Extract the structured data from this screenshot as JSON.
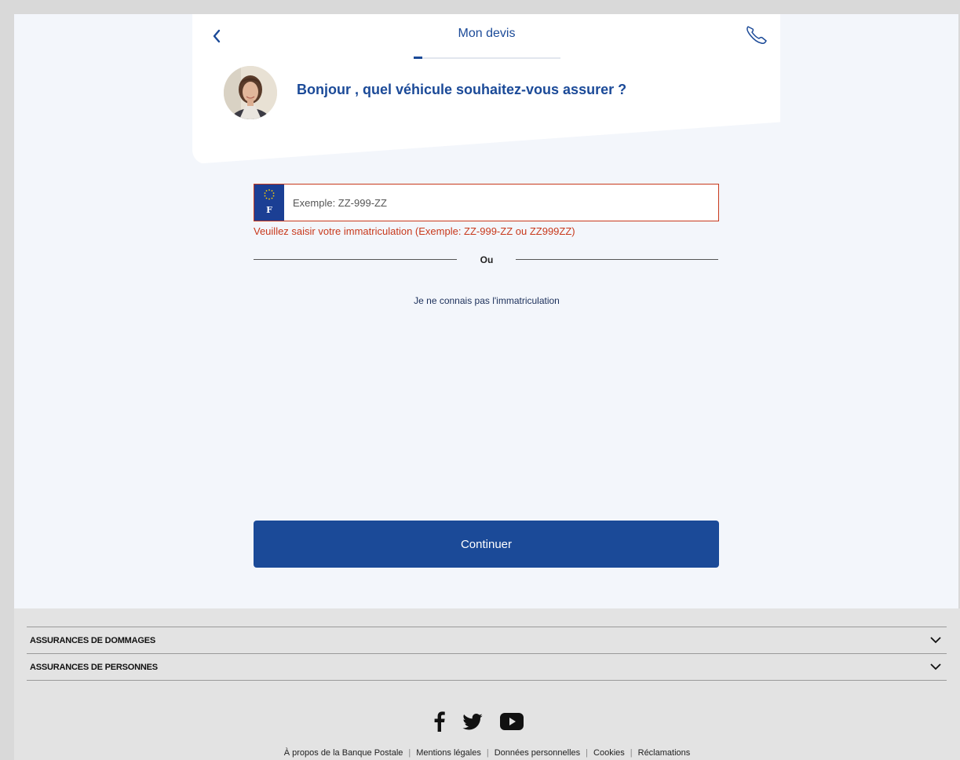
{
  "header": {
    "title": "Mon devis",
    "progress_fraction": 0.06
  },
  "chat": {
    "question": "Bonjour , quel véhicule souhaitez-vous assurer ?"
  },
  "plate": {
    "country_letter": "F",
    "placeholder": "Exemple: ZZ-999-ZZ",
    "value": "",
    "error": "Veuillez saisir votre immatriculation (Exemple: ZZ-999-ZZ ou ZZ999ZZ)"
  },
  "separator": {
    "label": "Ou"
  },
  "unknown_plate_link": "Je ne connais pas l'immatriculation",
  "continue_label": "Continuer",
  "footer": {
    "accordions": [
      {
        "label": "ASSURANCES DE DOMMAGES"
      },
      {
        "label": "ASSURANCES DE PERSONNES"
      }
    ],
    "social": [
      "facebook-icon",
      "twitter-icon",
      "youtube-icon"
    ],
    "links": [
      "À propos de la Banque Postale",
      "Mentions légales",
      "Données personnelles",
      "Cookies",
      "Réclamations"
    ]
  },
  "colors": {
    "brand_blue": "#1b4a98",
    "error_red": "#c8391c",
    "page_bg": "#f3f6fb",
    "footer_bg": "#e3e3e3"
  }
}
